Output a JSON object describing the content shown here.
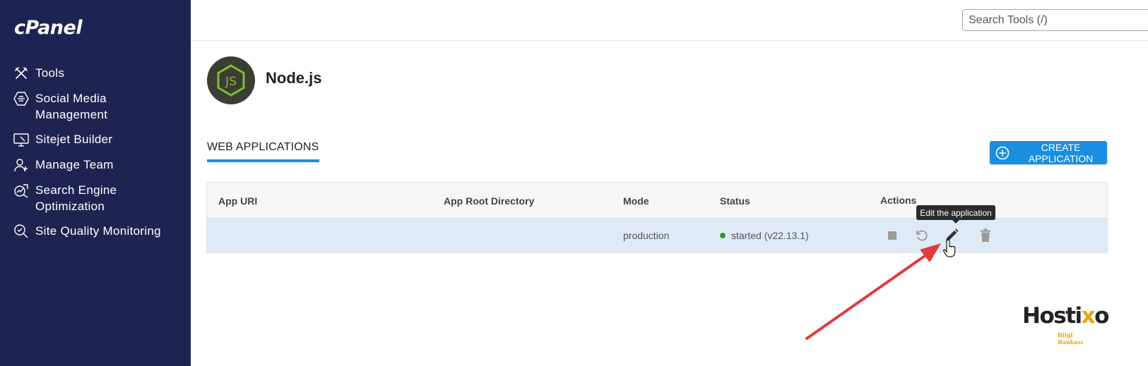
{
  "sidebar": {
    "logo": "cPanel",
    "items": [
      {
        "label": "Tools",
        "icon": "tools-icon"
      },
      {
        "label": "Social Media Management",
        "icon": "social-media-icon"
      },
      {
        "label": "Sitejet Builder",
        "icon": "sitejet-icon"
      },
      {
        "label": "Manage Team",
        "icon": "team-icon"
      },
      {
        "label": "Search Engine Optimization",
        "icon": "seo-icon"
      },
      {
        "label": "Site Quality Monitoring",
        "icon": "quality-monitor-icon"
      }
    ]
  },
  "header": {
    "search_placeholder": "Search Tools (/)"
  },
  "main": {
    "title": "Node.js",
    "app_logo_text": "JS",
    "tab_label": "WEB APPLICATIONS",
    "create_button_label": "CREATE APPLICATION",
    "table": {
      "columns": [
        "App URI",
        "App Root Directory",
        "Mode",
        "Status",
        "Actions"
      ],
      "rows": [
        {
          "app_uri": "",
          "app_root": "",
          "mode": "production",
          "status": "started (v22.13.1)"
        }
      ]
    },
    "tooltip": "Edit the application"
  },
  "watermark": {
    "brand_main": "Hosti",
    "brand_x": "x",
    "brand_end": "o",
    "brand_sub": "Bilgi Bankası"
  },
  "colors": {
    "sidebar_bg": "#1e2452",
    "accent": "#1a8fe0",
    "row_highlight": "#deebf7",
    "status_green": "#2ca02c",
    "arrow": "#e03c3c"
  }
}
